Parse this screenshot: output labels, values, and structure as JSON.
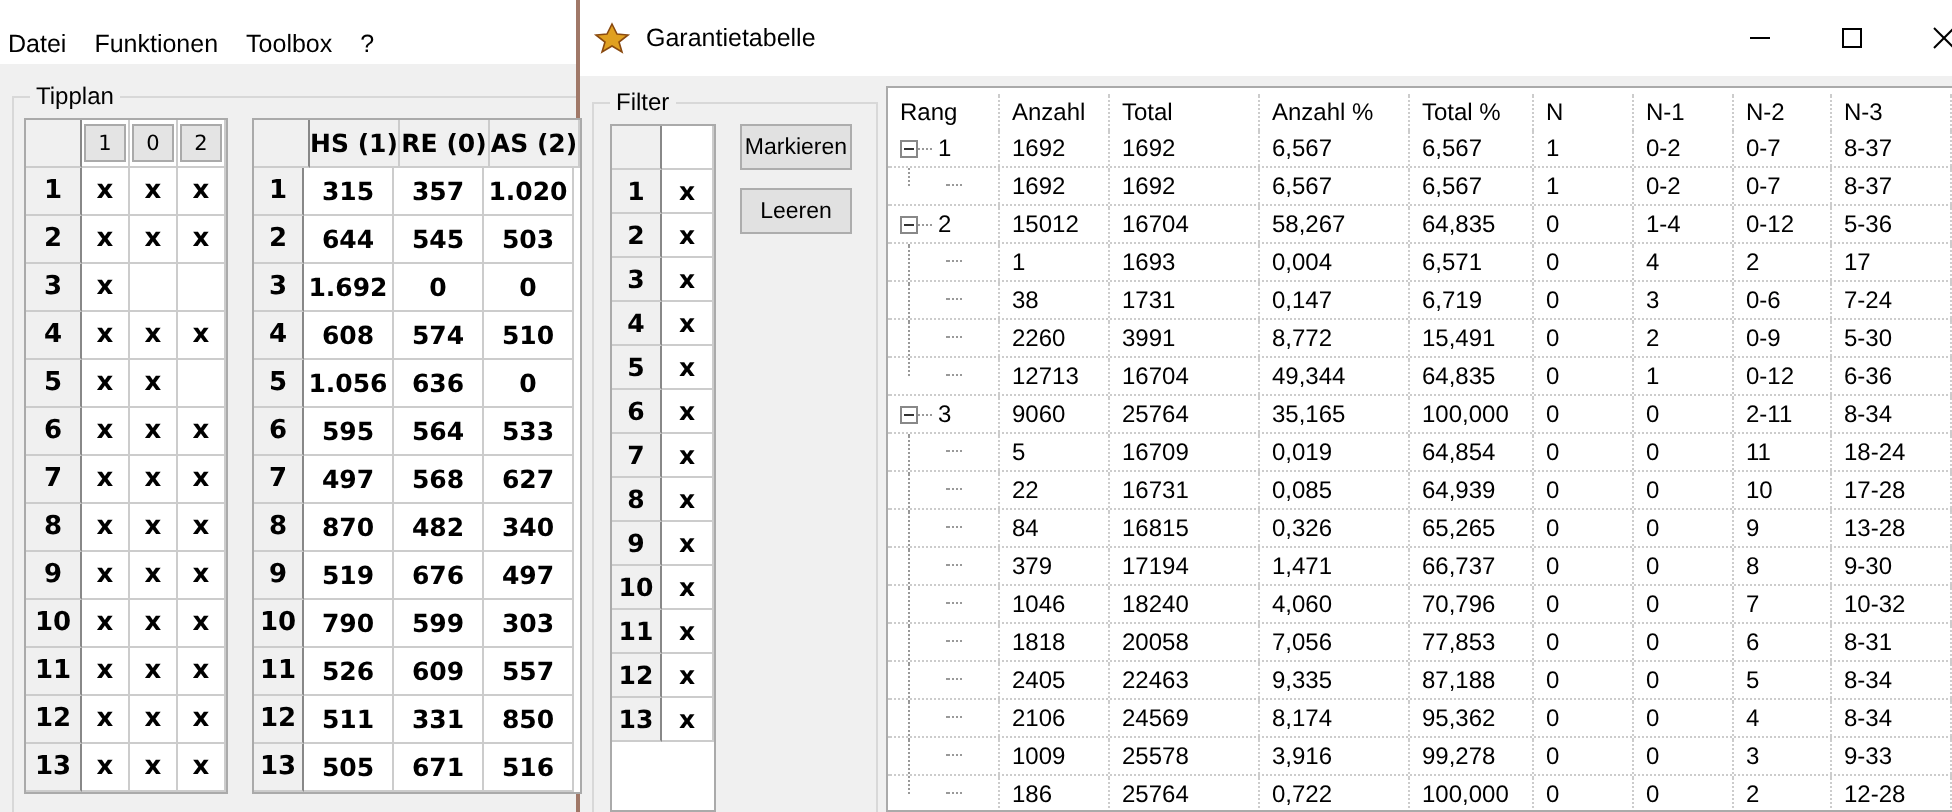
{
  "menu": [
    "Datei",
    "Funktionen",
    "Toolbox",
    "?"
  ],
  "tipplan": {
    "title": "Tipplan",
    "pick_headers": [
      "1",
      "0",
      "2"
    ],
    "pick_rows": [
      {
        "num": "1",
        "marks": [
          "x",
          "x",
          "x"
        ]
      },
      {
        "num": "2",
        "marks": [
          "x",
          "x",
          "x"
        ]
      },
      {
        "num": "3",
        "marks": [
          "x"
        ]
      },
      {
        "num": "4",
        "marks": [
          "x",
          "x",
          "x"
        ]
      },
      {
        "num": "5",
        "marks": [
          "x",
          "x"
        ]
      },
      {
        "num": "6",
        "marks": [
          "x",
          "x",
          "x"
        ]
      },
      {
        "num": "7",
        "marks": [
          "x",
          "x",
          "x"
        ]
      },
      {
        "num": "8",
        "marks": [
          "x",
          "x",
          "x"
        ]
      },
      {
        "num": "9",
        "marks": [
          "x",
          "x",
          "x"
        ]
      },
      {
        "num": "10",
        "marks": [
          "x",
          "x",
          "x"
        ]
      },
      {
        "num": "11",
        "marks": [
          "x",
          "x",
          "x"
        ]
      },
      {
        "num": "12",
        "marks": [
          "x",
          "x",
          "x"
        ]
      },
      {
        "num": "13",
        "marks": [
          "x",
          "x",
          "x"
        ]
      }
    ],
    "count_headers": [
      "HS (1)",
      "RE (0)",
      "AS (2)"
    ],
    "count_rows": [
      {
        "num": "1",
        "values": [
          "315",
          "357",
          "1.020"
        ]
      },
      {
        "num": "2",
        "values": [
          "644",
          "545",
          "503"
        ]
      },
      {
        "num": "3",
        "values": [
          "1.692",
          "0",
          "0"
        ]
      },
      {
        "num": "4",
        "values": [
          "608",
          "574",
          "510"
        ]
      },
      {
        "num": "5",
        "values": [
          "1.056",
          "636",
          "0"
        ]
      },
      {
        "num": "6",
        "values": [
          "595",
          "564",
          "533"
        ]
      },
      {
        "num": "7",
        "values": [
          "497",
          "568",
          "627"
        ]
      },
      {
        "num": "8",
        "values": [
          "870",
          "482",
          "340"
        ]
      },
      {
        "num": "9",
        "values": [
          "519",
          "676",
          "497"
        ]
      },
      {
        "num": "10",
        "values": [
          "790",
          "599",
          "303"
        ]
      },
      {
        "num": "11",
        "values": [
          "526",
          "609",
          "557"
        ]
      },
      {
        "num": "12",
        "values": [
          "511",
          "331",
          "850"
        ]
      },
      {
        "num": "13",
        "values": [
          "505",
          "671",
          "516"
        ]
      }
    ]
  },
  "dialog": {
    "title": "Garantietabelle",
    "filter": {
      "title": "Filter",
      "rows": [
        {
          "num": "1",
          "mark": "x"
        },
        {
          "num": "2",
          "mark": "x"
        },
        {
          "num": "3",
          "mark": "x"
        },
        {
          "num": "4",
          "mark": "x"
        },
        {
          "num": "5",
          "mark": "x"
        },
        {
          "num": "6",
          "mark": "x"
        },
        {
          "num": "7",
          "mark": "x"
        },
        {
          "num": "8",
          "mark": "x"
        },
        {
          "num": "9",
          "mark": "x"
        },
        {
          "num": "10",
          "mark": "x"
        },
        {
          "num": "11",
          "mark": "x"
        },
        {
          "num": "12",
          "mark": "x"
        },
        {
          "num": "13",
          "mark": "x"
        }
      ]
    },
    "buttons": [
      "Markieren",
      "Leeren"
    ],
    "columns": [
      "Rang",
      "Anzahl",
      "Total",
      "Anzahl %",
      "Total %",
      "N",
      "N-1",
      "N-2",
      "N-3"
    ],
    "groups": [
      {
        "rang": "1",
        "expanded": true,
        "values": [
          "1692",
          "1692",
          "6,567",
          "6,567",
          "1",
          "0-2",
          "0-7",
          "8-37"
        ],
        "children": [
          {
            "values": [
              "1692",
              "1692",
              "6,567",
              "6,567",
              "1",
              "0-2",
              "0-7",
              "8-37"
            ]
          }
        ]
      },
      {
        "rang": "2",
        "expanded": true,
        "values": [
          "15012",
          "16704",
          "58,267",
          "64,835",
          "0",
          "1-4",
          "0-12",
          "5-36"
        ],
        "children": [
          {
            "values": [
              "1",
              "1693",
              "0,004",
              "6,571",
              "0",
              "4",
              "2",
              "17"
            ]
          },
          {
            "values": [
              "38",
              "1731",
              "0,147",
              "6,719",
              "0",
              "3",
              "0-6",
              "7-24"
            ]
          },
          {
            "values": [
              "2260",
              "3991",
              "8,772",
              "15,491",
              "0",
              "2",
              "0-9",
              "5-30"
            ]
          },
          {
            "values": [
              "12713",
              "16704",
              "49,344",
              "64,835",
              "0",
              "1",
              "0-12",
              "6-36"
            ]
          }
        ]
      },
      {
        "rang": "3",
        "expanded": true,
        "values": [
          "9060",
          "25764",
          "35,165",
          "100,000",
          "0",
          "0",
          "2-11",
          "8-34"
        ],
        "children": [
          {
            "values": [
              "5",
              "16709",
              "0,019",
              "64,854",
              "0",
              "0",
              "11",
              "18-24"
            ]
          },
          {
            "values": [
              "22",
              "16731",
              "0,085",
              "64,939",
              "0",
              "0",
              "10",
              "17-28"
            ]
          },
          {
            "values": [
              "84",
              "16815",
              "0,326",
              "65,265",
              "0",
              "0",
              "9",
              "13-28"
            ]
          },
          {
            "values": [
              "379",
              "17194",
              "1,471",
              "66,737",
              "0",
              "0",
              "8",
              "9-30"
            ]
          },
          {
            "values": [
              "1046",
              "18240",
              "4,060",
              "70,796",
              "0",
              "0",
              "7",
              "10-32"
            ]
          },
          {
            "values": [
              "1818",
              "20058",
              "7,056",
              "77,853",
              "0",
              "0",
              "6",
              "8-31"
            ]
          },
          {
            "values": [
              "2405",
              "22463",
              "9,335",
              "87,188",
              "0",
              "0",
              "5",
              "8-34"
            ]
          },
          {
            "values": [
              "2106",
              "24569",
              "8,174",
              "95,362",
              "0",
              "0",
              "4",
              "8-34"
            ]
          },
          {
            "values": [
              "1009",
              "25578",
              "3,916",
              "99,278",
              "0",
              "0",
              "3",
              "9-33"
            ]
          },
          {
            "values": [
              "186",
              "25764",
              "0,722",
              "100,000",
              "0",
              "0",
              "2",
              "12-28"
            ]
          }
        ]
      }
    ]
  }
}
